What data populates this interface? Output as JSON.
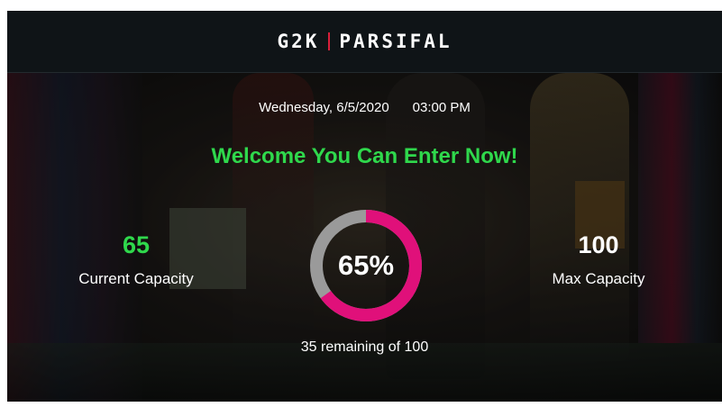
{
  "header": {
    "brand_left": "G2K",
    "brand_right": "PARSIFAL"
  },
  "hero": {
    "date": "Wednesday, 6/5/2020",
    "time": "03:00 PM",
    "welcome": "Welcome You Can Enter Now!"
  },
  "capacity": {
    "current_value": "65",
    "current_label": "Current Capacity",
    "max_value": "100",
    "max_label": "Max Capacity",
    "percent_text": "65%",
    "percent": 65,
    "remaining_text": "35 remaining of 100"
  },
  "colors": {
    "accent_green": "#2fd84c",
    "gauge_fill": "#e0107a",
    "gauge_track": "#9a9a9a",
    "brand_separator": "#d81f3a"
  }
}
